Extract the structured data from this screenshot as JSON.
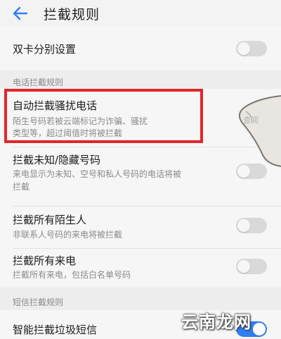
{
  "header": {
    "title": "拦截规则"
  },
  "dual_sim": {
    "label": "双卡分别设置",
    "enabled": false
  },
  "call_section": {
    "label": "电话拦截规则"
  },
  "rules": [
    {
      "title": "自动拦截骚扰电话",
      "desc_line1": "陌生号码若被云端标记为诈骗、骚扰",
      "desc_line2": "类型等，超过阈值时将被拦截",
      "right_hint": "查阅"
    },
    {
      "title": "拦截未知/隐藏号码",
      "desc_line1": "来电显示为未知、空号和私人号码的电话将被",
      "desc_line2": "拦截",
      "enabled": false
    },
    {
      "title": "拦截所有陌生人",
      "desc_line1": "非联系人号码的来电将被拦截",
      "enabled": false
    },
    {
      "title": "拦截所有来电",
      "desc_line1": "拦截所有来电，包括白名单号码",
      "enabled": false
    }
  ],
  "sms_section": {
    "label": "短信拦截规则"
  },
  "sms_rule": {
    "title": "智能拦截垃圾短信",
    "enabled": true
  },
  "watermark": {
    "text": "云南龙网"
  },
  "colors": {
    "accent": "#2f7ef5",
    "highlight": "#e0262b",
    "toggle_off": "#d9d9d9"
  },
  "icons": {
    "back": "back-arrow-icon"
  }
}
